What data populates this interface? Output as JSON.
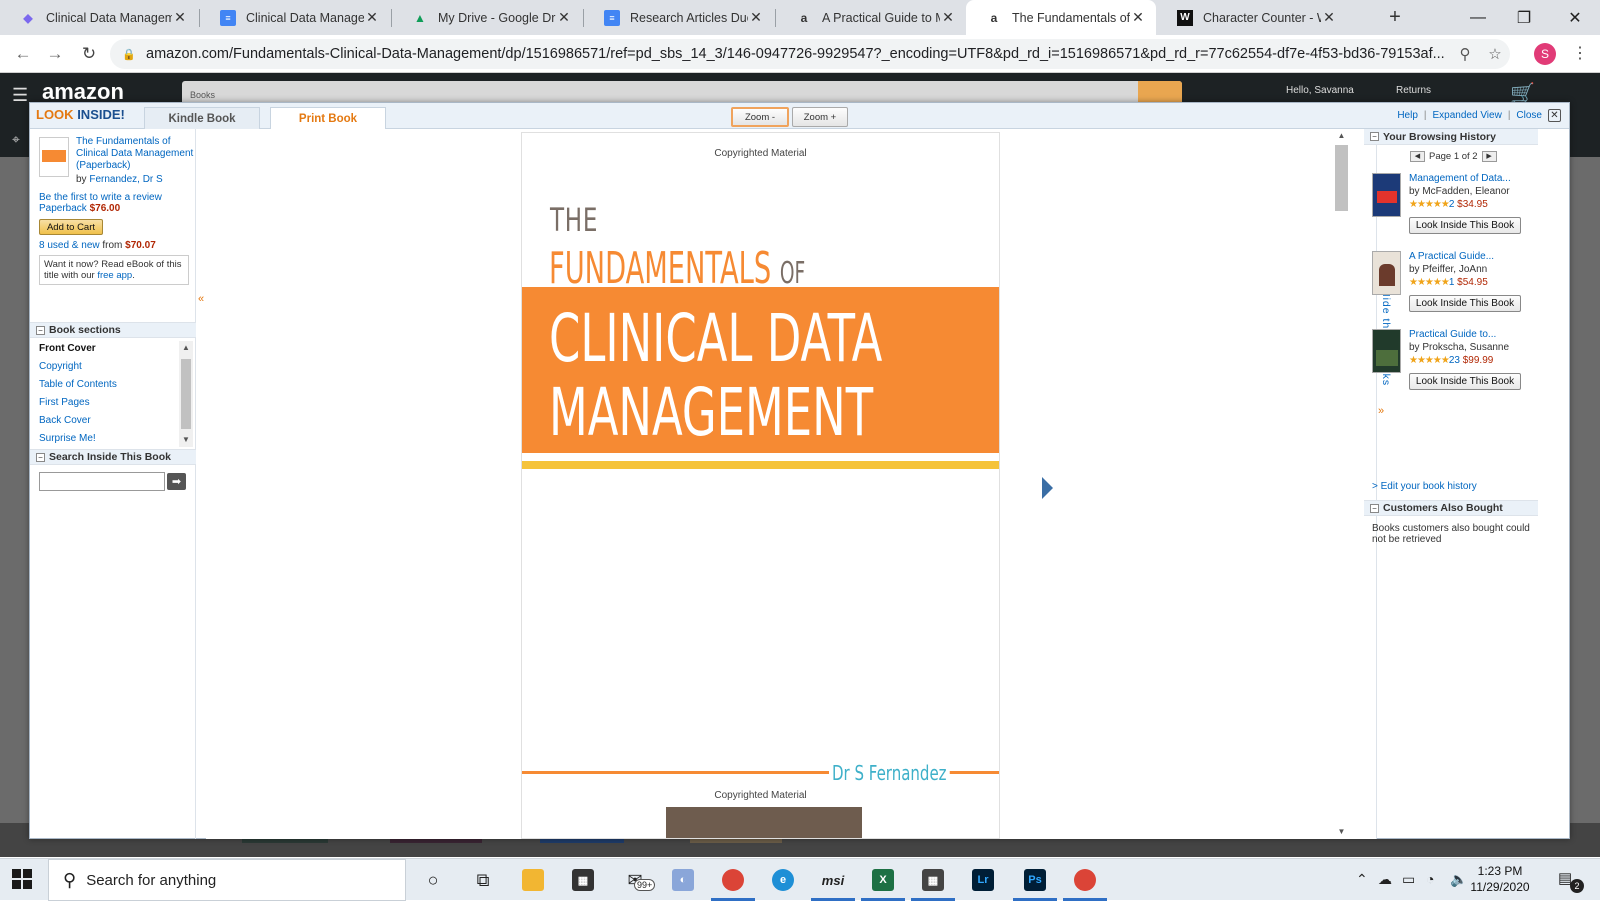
{
  "browser": {
    "tabs": [
      {
        "title": "Clinical Data Managem",
        "icon": "clickup-icon",
        "color": "#7b68ee"
      },
      {
        "title": "Clinical Data Managem",
        "icon": "google-docs-icon",
        "color": "#4285f4"
      },
      {
        "title": "My Drive - Google Driv",
        "icon": "google-drive-icon",
        "color": "#0f9d58"
      },
      {
        "title": "Research Articles Due",
        "icon": "google-docs-icon",
        "color": "#4285f4"
      },
      {
        "title": "A Practical Guide to M",
        "icon": "amazon-icon",
        "color": "#111111"
      },
      {
        "title": "The Fundamentals of C",
        "icon": "amazon-icon",
        "color": "#111111"
      },
      {
        "title": "Character Counter - W",
        "icon": "wordcounter-icon",
        "color": "#111111"
      }
    ],
    "new_tab": "+",
    "url": "amazon.com/Fundamentals-Clinical-Data-Management/dp/1516986571/ref=pd_sbs_14_3/146-0947726-9929547?_encoding=UTF8&pd_rd_i=1516986571&pd_rd_r=77c62554-df7e-4f53-bd36-79153af...",
    "profile_initial": "S"
  },
  "amazon": {
    "logo": "amazon",
    "search_dept": "Books",
    "hello": "Hello, Savanna",
    "returns": "Returns"
  },
  "look_inside": {
    "logo_look": "LOOK",
    "logo_inside": "INSIDE!",
    "tabs": [
      "Kindle Book",
      "Print Book"
    ],
    "zoom_out": "Zoom -",
    "zoom_in": "Zoom +",
    "help": "Help",
    "expanded_view": "Expanded View",
    "close": "Close"
  },
  "book": {
    "title": "The Fundamentals of Clinical Data Management (Paperback)",
    "by": "by",
    "author": "Fernandez, Dr S",
    "review_prompt": "Be the first to write a review",
    "format": "Paperback",
    "price": "$76.00",
    "add_to_cart": "Add to Cart",
    "used_new": "8 used & new",
    "from": "from",
    "used_price": "$70.07",
    "ebook_text": "Want it now? Read eBook of this title with our",
    "ebook_link": "free app",
    "ebook_end": "."
  },
  "sections": {
    "header": "Book sections",
    "items": [
      "Front Cover",
      "Copyright",
      "Table of Contents",
      "First Pages",
      "Back Cover",
      "Surprise Me!"
    ],
    "search_header": "Search Inside This Book",
    "search_value": ""
  },
  "cover": {
    "copyright_top": "Copyrighted Material",
    "the": "THE",
    "fundamentals": "FUNDAMENTALS",
    "of": "OF",
    "line1": "CLINICAL DATA",
    "line2": "MANAGEMENT",
    "author": "Dr S Fernandez",
    "copyright_bottom": "Copyrighted Material",
    "orange": "#f68a33",
    "yellow": "#f5c33a",
    "author_color": "#3eb0c9"
  },
  "right_panel": {
    "history_header": "Your Browsing History",
    "pager": "Page 1 of 2",
    "hide_books": "Hide these books",
    "items": [
      {
        "title": "Management of Data...",
        "author": "by McFadden, Eleanor",
        "stars": "★★★★★",
        "count": "2",
        "price": "$34.95",
        "button": "Look Inside This Book"
      },
      {
        "title": "A Practical Guide...",
        "author": "by Pfeiffer, JoAnn",
        "stars": "★★★★★",
        "count": "1",
        "price": "$54.95",
        "button": "Look Inside This Book"
      },
      {
        "title": "Practical Guide to...",
        "author": "by Prokscha, Susanne",
        "stars": "★★★★★",
        "count": "23",
        "price": "$99.99",
        "button": "Look Inside This Book"
      }
    ],
    "edit_history": "> Edit your book history",
    "also_bought_header": "Customers Also Bought",
    "also_bought_msg": "Books customers also bought could not be retrieved"
  },
  "taskbar": {
    "search_placeholder": "Search for anything",
    "mail_badge": "99+",
    "time": "1:23 PM",
    "date": "11/29/2020",
    "notification_count": "2"
  }
}
